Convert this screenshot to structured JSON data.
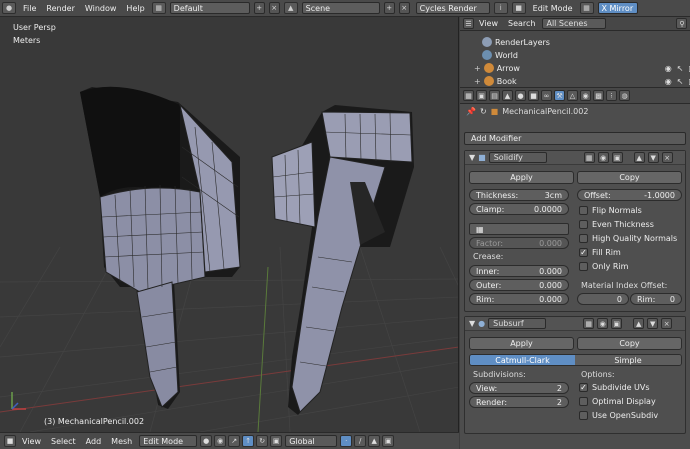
{
  "topbar": {
    "menus": [
      "File",
      "Render",
      "Window",
      "Help"
    ],
    "layout": "Default",
    "scene": "Scene",
    "engine": "Cycles Render",
    "mode": "Edit Mode",
    "mirror": "X Mirror"
  },
  "viewport": {
    "view_name": "User Persp",
    "units": "Meters",
    "object_label": "(3) MechanicalPencil.002"
  },
  "bottombar": {
    "menus": [
      "View",
      "Select",
      "Add",
      "Mesh"
    ],
    "mode": "Edit Mode",
    "orientation": "Global"
  },
  "outliner": {
    "menus": [
      "View",
      "Search"
    ],
    "filter": "All Scenes",
    "items": [
      {
        "label": "RenderLayers"
      },
      {
        "label": "World"
      },
      {
        "label": "Arrow"
      },
      {
        "label": "Book"
      }
    ]
  },
  "properties": {
    "context": "MechanicalPencil.002",
    "add_modifier": "Add Modifier",
    "solidify": {
      "name": "Solidify",
      "apply": "Apply",
      "copy": "Copy",
      "thickness_label": "Thickness:",
      "thickness": "3cm",
      "clamp_label": "Clamp:",
      "clamp": "0.0000",
      "factor_label": "Factor:",
      "factor": "0.000",
      "crease_label": "Crease:",
      "inner_label": "Inner:",
      "inner": "0.000",
      "outer_label": "Outer:",
      "outer": "0.000",
      "rim_label": "Rim:",
      "rim": "0.000",
      "offset_label": "Offset:",
      "offset": "-1.0000",
      "flip_normals": "Flip Normals",
      "even_thickness": "Even Thickness",
      "high_quality_normals": "High Quality Normals",
      "fill_rim": "Fill Rim",
      "only_rim": "Only Rim",
      "mat_index_label": "Material Index Offset:",
      "mat_index": "0",
      "mat_rim_label": "Rim:",
      "mat_rim": "0"
    },
    "subsurf": {
      "name": "Subsurf",
      "apply": "Apply",
      "copy": "Copy",
      "catmull": "Catmull-Clark",
      "simple": "Simple",
      "subdivisions_label": "Subdivisions:",
      "view_label": "View:",
      "view": "2",
      "render_label": "Render:",
      "render": "2",
      "options_label": "Options:",
      "subdivide_uvs": "Subdivide UVs",
      "optimal_display": "Optimal Display",
      "use_opensubdiv": "Use OpenSubdiv"
    }
  },
  "colors": {
    "accent": "#5f8ec4",
    "panel": "#4d4d4d",
    "viewport_bg": "#393939"
  }
}
